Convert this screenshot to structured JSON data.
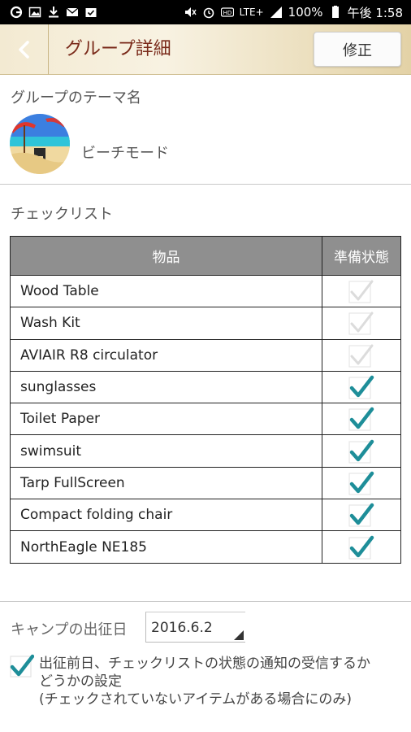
{
  "status_bar": {
    "battery": "100%",
    "time": "午後 1:58",
    "network": "LTE+"
  },
  "header": {
    "title": "グループ詳細",
    "edit_label": "修正"
  },
  "theme": {
    "section_label": "グループのテーマ名",
    "name": "ビーチモード"
  },
  "checklist": {
    "section_label": "チェックリスト",
    "columns": [
      "物品",
      "準備状態"
    ],
    "items": [
      {
        "name": "Wood Table",
        "checked": false
      },
      {
        "name": "Wash Kit",
        "checked": false
      },
      {
        "name": "AVIAIR R8 circulator",
        "checked": false
      },
      {
        "name": "sunglasses",
        "checked": true
      },
      {
        "name": "Toilet Paper",
        "checked": true
      },
      {
        "name": "swimsuit",
        "checked": true
      },
      {
        "name": "Tarp FullScreen",
        "checked": true
      },
      {
        "name": "Compact folding chair",
        "checked": true
      },
      {
        "name": "NorthEagle NE185",
        "checked": true
      }
    ]
  },
  "departure": {
    "label": "キャンプの出征日",
    "date": "2016.6.2"
  },
  "notification": {
    "checked": true,
    "line1": "出征前日、チェックリストの状態の通知の受信するか",
    "line2": "どうかの設定",
    "line3": "(チェックされていないアイテムがある場合にのみ)"
  },
  "colors": {
    "accent_teal": "#1e8e99",
    "title_brown": "#7a2a1a",
    "table_header": "#8f8f8f"
  }
}
